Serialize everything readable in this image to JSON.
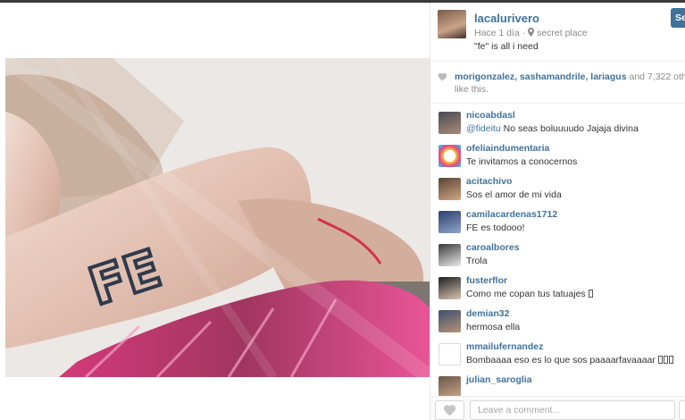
{
  "post": {
    "username": "lacalurivero",
    "time": "Hace 1 día",
    "location": "secret place",
    "caption": "\"fe\" is all i need",
    "follow_label": "Se",
    "photo_tattoo_text": "FE"
  },
  "likes": {
    "names": "morigonzalez, sashamandrile, lariagus",
    "suffix_first": " and 7,322 oth",
    "suffix_second": "like this."
  },
  "comments": [
    {
      "user": "nicoabdasl",
      "mention": "@fideitu",
      "text": " No seas boluuuudo Jajaja divina",
      "avatar_colors": [
        "#4a4a52",
        "#a98b79"
      ]
    },
    {
      "user": "ofeliaindumentaria",
      "mention": "",
      "text": "Te invitamos a conocernos",
      "avatar_colors": [
        "#e8458b",
        "#f6c12f"
      ]
    },
    {
      "user": "acitachivo",
      "mention": "",
      "text": "Sos el amor de mi vida",
      "avatar_colors": [
        "#5a4335",
        "#cfa781"
      ]
    },
    {
      "user": "camilacardenas1712",
      "mention": "",
      "text": "FE es todooo!",
      "avatar_colors": [
        "#2c3e6b",
        "#8fa6c9"
      ]
    },
    {
      "user": "caroalbores",
      "mention": "",
      "text": "Trola",
      "avatar_colors": [
        "#3b3b3b",
        "#e9e9e9"
      ]
    },
    {
      "user": "fusterflor",
      "mention": "",
      "text": "Como me copan tus tatuajes ",
      "avatar_colors": [
        "#1f1f1f",
        "#d8c3b4"
      ]
    },
    {
      "user": "demian32",
      "mention": "",
      "text": "hermosa ella",
      "avatar_colors": [
        "#3d4f6f",
        "#b69277"
      ]
    },
    {
      "user": "mmailufernandez",
      "mention": "",
      "text": "Bombaaaa eso es lo que sos paaaarfavaaaar ",
      "avatar_colors": [
        "#ffffff",
        "#ffffff"
      ]
    },
    {
      "user": "julian_saroglia",
      "mention": "",
      "text": "",
      "avatar_colors": [
        "#6b5646",
        "#caa98c"
      ]
    }
  ],
  "comment_box": {
    "placeholder": "Leave a comment..."
  },
  "colors": {
    "link_blue": "#3f729b",
    "meta_gray": "#8a8a8a"
  }
}
